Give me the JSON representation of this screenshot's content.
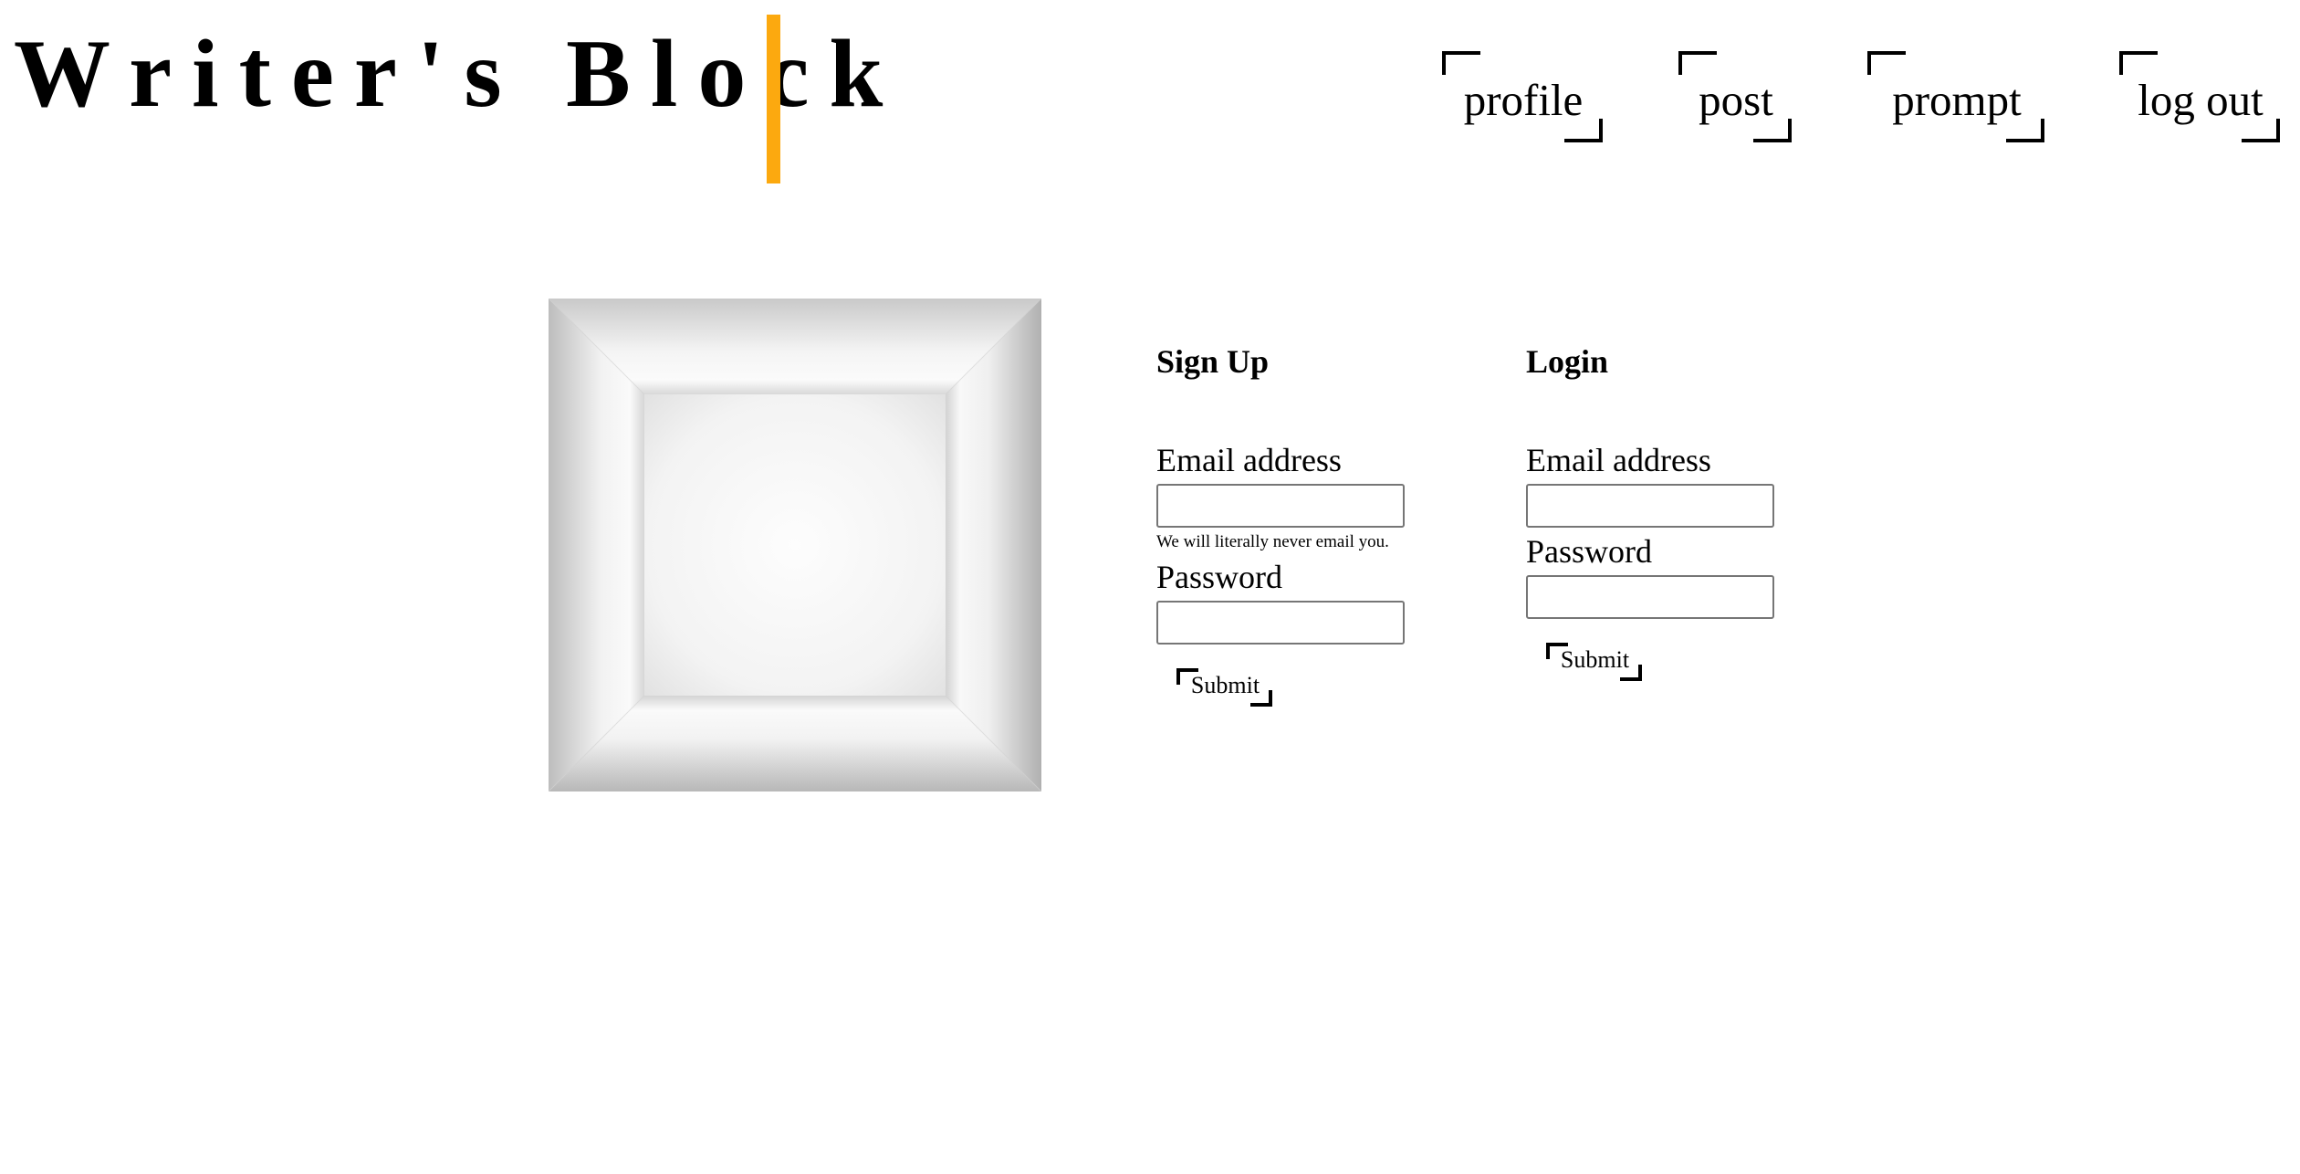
{
  "header": {
    "site_title": "Writer's Block",
    "cursor_color": "#fca90f"
  },
  "nav": {
    "items": [
      {
        "label": "profile"
      },
      {
        "label": "post"
      },
      {
        "label": "prompt"
      },
      {
        "label": "log out"
      }
    ]
  },
  "illustration": {
    "icon": "empty-box-icon"
  },
  "signup": {
    "heading": "Sign Up",
    "email_label": "Email address",
    "email_value": "",
    "email_help": "We will literally never email you.",
    "password_label": "Password",
    "password_value": "",
    "submit_label": "Submit"
  },
  "login": {
    "heading": "Login",
    "email_label": "Email address",
    "email_value": "",
    "password_label": "Password",
    "password_value": "",
    "submit_label": "Submit"
  }
}
